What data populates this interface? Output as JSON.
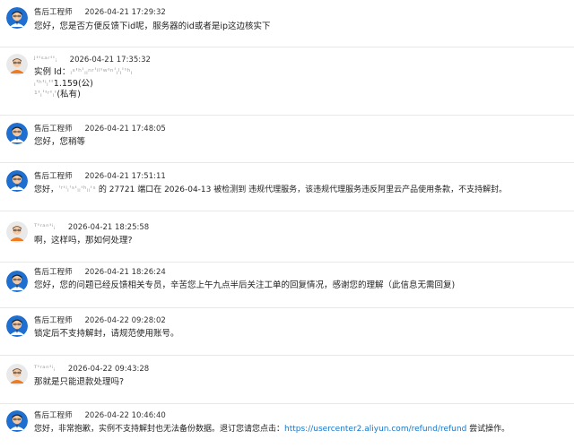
{
  "messages": [
    {
      "role": "agent",
      "name": "售后工程师",
      "time": "2026-04-21 17:29:32",
      "parts": [
        "您好，您是否方便反馈下id呢，服务器的id或者是ip这边核实下"
      ]
    },
    {
      "role": "customer",
      "name": "ᴶ''ˢᵃʳ''ᵢ",
      "time": "2026-04-21 17:35:32",
      "lines": [
        {
          "pre": "实例 Id：",
          "redacted": "ᵢˢ'ʰˈᵢᵢⁿʳˈⁱˡ'ʷ'ⁿˈᵢˡᵢˈ'ʰᵢ",
          "post": ""
        },
        {
          "pre": "",
          "redacted": "ᵢ'ʰ'ⁱᵢ''",
          "post": "1.159(公)"
        },
        {
          "pre": "",
          "redacted": "¹'ᵢˈ'ʳ'ᵢ'",
          "post": "(私有)"
        }
      ]
    },
    {
      "role": "agent",
      "name": "售后工程师",
      "time": "2026-04-21 17:48:05",
      "parts": [
        "您好，您稍等"
      ]
    },
    {
      "role": "agent",
      "name": "售后工程师",
      "time": "2026-04-21 17:51:11",
      "pre": "您好，",
      "redacted": "ˈʳ'ⁱᵢˈˢ'ᵢᵢ'ʰᵢᵢ'ˢ",
      "post": " 的 27721 端口在 2026-04-13 被检测到 违规代理服务，该违规代理服务违反阿里云产品使用条款，不支持解封。"
    },
    {
      "role": "customer",
      "name": "ᵀ'ʳᵃⁿ'ⁱᵢ",
      "time": "2026-04-21 18:25:58",
      "parts": [
        "啊，这样吗，那如何处理?"
      ]
    },
    {
      "role": "agent",
      "name": "售后工程师",
      "time": "2026-04-21 18:26:24",
      "parts": [
        "您好，您的问题已经反馈相关专员，辛苦您上午九点半后关注工单的回复情况，感谢您的理解（此信息无需回复)"
      ]
    },
    {
      "role": "agent",
      "name": "售后工程师",
      "time": "2026-04-22 09:28:02",
      "parts": [
        "锁定后不支持解封，请规范使用账号。"
      ]
    },
    {
      "role": "customer",
      "name": "ᵀ'ʳᵃⁿ'ⁱᵢ",
      "time": "2026-04-22 09:43:28",
      "parts": [
        "那就是只能退款处理吗?"
      ]
    },
    {
      "role": "agent",
      "name": "售后工程师",
      "time": "2026-04-22 10:46:40",
      "pre": "您好，非常抱歉，实例不支持解封也无法备份数据。退订您请您点击：",
      "link": "https://usercenter2.aliyun.com/refund/refund",
      "post": " 尝试操作。"
    }
  ]
}
